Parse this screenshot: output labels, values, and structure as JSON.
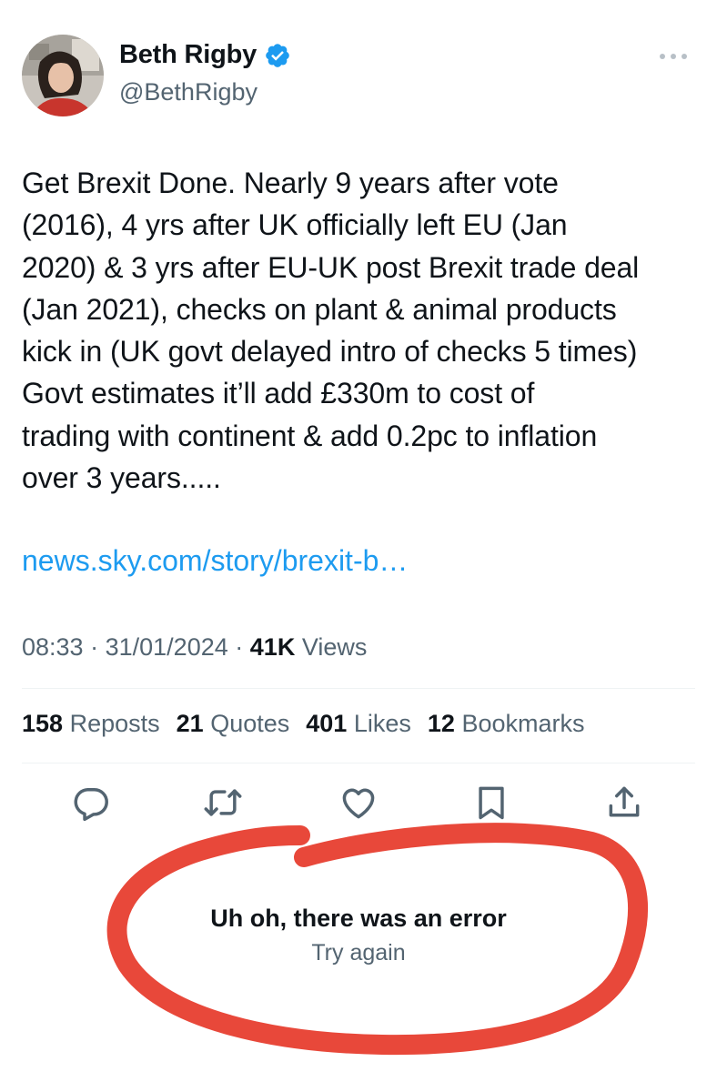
{
  "author": {
    "name": "Beth Rigby",
    "handle": "@BethRigby"
  },
  "tweet": {
    "text": "Get Brexit Done. Nearly 9 years after vote\n(2016), 4 yrs after UK officially left EU (Jan\n2020) & 3 yrs after EU-UK post Brexit trade deal\n(Jan 2021), checks on plant & animal products\nkick in (UK govt delayed intro of checks 5 times)\nGovt estimates it’ll add £330m to cost of\ntrading with continent & add 0.2pc to inflation\nover 3 years.....",
    "link": "news.sky.com/story/brexit-b…",
    "time": "08:33",
    "date": "31/01/2024",
    "separator": "·",
    "views_count": "41K",
    "views_label": "Views"
  },
  "stats": [
    {
      "count": "158",
      "label": "Reposts"
    },
    {
      "count": "21",
      "label": "Quotes"
    },
    {
      "count": "401",
      "label": "Likes"
    },
    {
      "count": "12",
      "label": "Bookmarks"
    }
  ],
  "actions": [
    {
      "icon": "reply-icon"
    },
    {
      "icon": "repost-icon"
    },
    {
      "icon": "like-icon"
    },
    {
      "icon": "bookmark-icon"
    },
    {
      "icon": "share-icon"
    }
  ],
  "error": {
    "title": "Uh oh, there was an error",
    "retry": "Try again"
  },
  "colors": {
    "link": "#1d9bf0",
    "verified": "#1d9bf0",
    "muted": "#536471",
    "annotation": "#e8483a"
  }
}
